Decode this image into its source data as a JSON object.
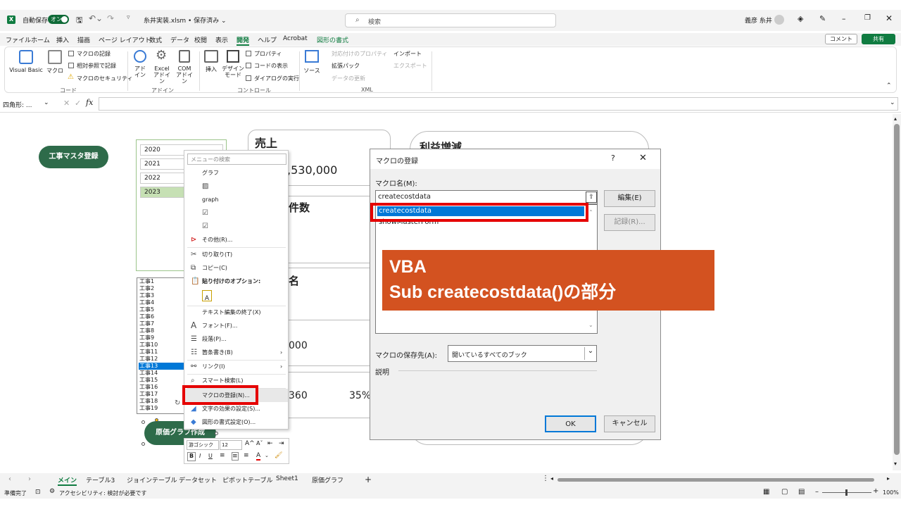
{
  "titlebar": {
    "autosave_label": "自動保存",
    "autosave_state": "オン",
    "filename": "糸井実装.xlsm • 保存済み ⌄",
    "search_placeholder": "検索",
    "user": "義彦 糸井"
  },
  "menu": [
    "ファイル",
    "ホーム",
    "挿入",
    "描画",
    "ページ レイアウト",
    "数式",
    "データ",
    "校閲",
    "表示",
    "開発",
    "ヘルプ",
    "Acrobat",
    "図形の書式"
  ],
  "menu_right": {
    "comment": "コメント",
    "share": "共有"
  },
  "ribbon": {
    "visual_basic": "Visual Basic",
    "macro": "マクロ",
    "record_macro": "マクロの記録",
    "relative_ref": "相対参照で記録",
    "macro_security": "マクロのセキュリティ",
    "group_code": "コード",
    "addin": "アド\nイン",
    "excel_addin": "Excel\nアドイン",
    "com_addin": "COM\nアドイン",
    "group_addin": "アドイン",
    "insert": "挿入",
    "design_mode": "デザイン\nモード",
    "properties": "プロパティ",
    "view_code": "コードの表示",
    "run_dialog": "ダイアログの実行",
    "group_control": "コントロール",
    "source": "ソース",
    "map_props": "対応付けのプロパティ",
    "expansion_pack": "拡張パック",
    "refresh_data": "データの更新",
    "import": "インポート",
    "export": "エクスポート",
    "group_xml": "XML"
  },
  "formula_bar": {
    "name_box": "四角形: ..."
  },
  "sheet": {
    "btn_master": "工事マスタ登録",
    "btn_graph": "原価グラフ作成",
    "years": [
      "2020",
      "2021",
      "2022",
      "2023"
    ],
    "selected_year": "2023",
    "list_items": [
      "工事1",
      "工事2",
      "工事3",
      "工事4",
      "工事5",
      "工事6",
      "工事7",
      "工事8",
      "工事9",
      "工事10",
      "工事11",
      "工事12",
      "工事13",
      "工事14",
      "工事15",
      "工事16",
      "工事17",
      "工事18",
      "工事19"
    ],
    "selected_list_item": "工事13",
    "card_sales_title": "売上",
    "card_sales_value": ",530,000",
    "card_count_title": "件数",
    "card_name_title": "名",
    "card_value_000": "000",
    "card_value_360": "360",
    "card_value_pct": "35%",
    "card_profit_title": "利益増減"
  },
  "context_menu": {
    "search_placeholder": "メニューの検索",
    "items": [
      "グラフ",
      "graph",
      "その他(R)...",
      "切り取り(T)",
      "コピー(C)",
      "貼り付けのオプション:",
      "テキスト編集の終了(X)",
      "フォント(F)...",
      "段落(P)...",
      "箇条書き(B)",
      "リンク(I)",
      "スマート検索(L)",
      "マクロの登録(N)...",
      "文字の効果の設定(S)...",
      "図形の書式設定(O)..."
    ]
  },
  "minitoolbar": {
    "font": "游ゴシック",
    "size": "12"
  },
  "dialog": {
    "title": "マクロの登録",
    "help": "?",
    "macro_name_label": "マクロ名(M):",
    "macro_name_value": "createcostdata",
    "macros": [
      "createcostdata",
      "showMasterForm"
    ],
    "selected_macro": "createcostdata",
    "edit_btn": "編集(E)",
    "record_btn": "記録(R)...",
    "save_in_label": "マクロの保存先(A):",
    "save_in_value": "開いているすべてのブック",
    "description_label": "説明",
    "ok": "OK",
    "cancel": "キャンセル"
  },
  "annotation": {
    "line1": "VBA",
    "line2": "Sub createcostdata()の部分"
  },
  "tabs": [
    "メイン",
    "テーブル3",
    "ジョインテーブル",
    "データセット",
    "ピボットテーブル",
    "Sheet1",
    "原価グラフ"
  ],
  "active_tab": "メイン",
  "status": {
    "ready": "準備完了",
    "accessibility": "アクセシビリティ: 検討が必要です",
    "zoom": "100%"
  },
  "colors": {
    "excel_green": "#107c41",
    "shape_green": "#2e6b4a",
    "highlight_red": "#e50000",
    "annotation_orange": "#d35220",
    "selection_blue": "#0078d7"
  }
}
